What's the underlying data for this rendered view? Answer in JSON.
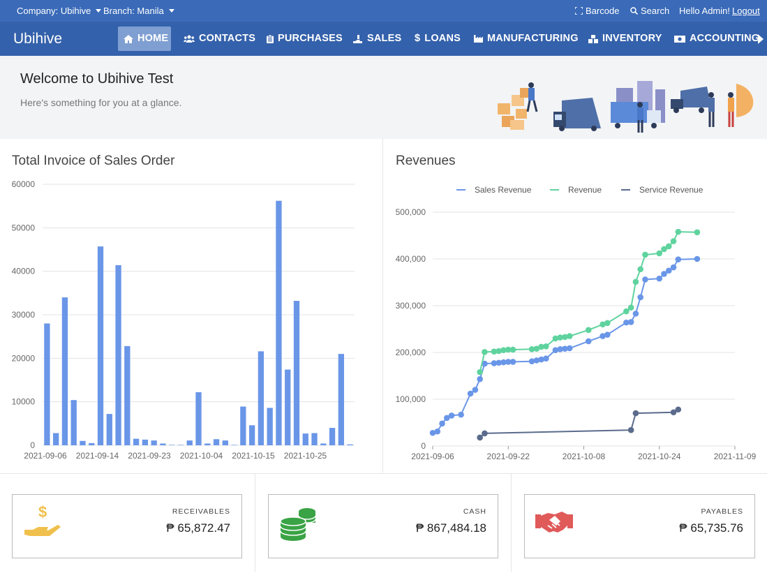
{
  "topbar": {
    "company": "Company: Ubihive",
    "branch": "Branch: Manila",
    "barcode": "Barcode",
    "search": "Search",
    "greeting": "Hello Admin!",
    "logout": "Logout"
  },
  "nav": {
    "brand": "Ubihive",
    "items": [
      {
        "label": "HOME",
        "icon": "home-icon"
      },
      {
        "label": "CONTACTS",
        "icon": "users-icon"
      },
      {
        "label": "PURCHASES",
        "icon": "clipboard-icon"
      },
      {
        "label": "SALES",
        "icon": "hand-coins-icon"
      },
      {
        "label": "LOANS",
        "icon": "dollar-icon"
      },
      {
        "label": "MANUFACTURING",
        "icon": "factory-icon"
      },
      {
        "label": "INVENTORY",
        "icon": "boxes-icon"
      },
      {
        "label": "ACCOUNTING",
        "icon": "money-bill-icon"
      }
    ]
  },
  "welcome": {
    "title": "Welcome to Ubihive Test",
    "subtitle": "Here's something for you at a glance."
  },
  "colors": {
    "topbar": "#3a6ab8",
    "navbar": "#3461ab",
    "bar": "#6a96e8",
    "sales_revenue": "#6a96e8",
    "revenue": "#5fd39e",
    "service_revenue": "#5a6b8c",
    "receivables_icon": "#f0c04c",
    "cash_icon": "#3aa345",
    "payables_icon": "#e05a5a"
  },
  "chart_data": [
    {
      "type": "bar",
      "title": "Total Invoice of Sales Order",
      "ylim": [
        0,
        60000
      ],
      "yticks": [
        0,
        10000,
        20000,
        30000,
        40000,
        50000,
        60000
      ],
      "xtick_labels": [
        "2021-09-06",
        "2021-09-14",
        "2021-09-23",
        "2021-10-04",
        "2021-10-15",
        "2021-10-25"
      ],
      "values": [
        28000,
        2800,
        34000,
        10400,
        1000,
        500,
        45700,
        7200,
        41400,
        22800,
        1500,
        1300,
        1100,
        400,
        100,
        100,
        1100,
        12200,
        400,
        1400,
        1100,
        100,
        8900,
        4600,
        21600,
        8600,
        56200,
        17400,
        33200,
        2700,
        2800,
        400,
        4000,
        21000,
        200
      ],
      "grid": true,
      "legend": "none"
    },
    {
      "type": "line",
      "title": "Revenues",
      "ylim": [
        0,
        500000
      ],
      "yticks": [
        "0",
        "100,000",
        "200,000",
        "300,000",
        "400,000",
        "500,000"
      ],
      "xtick_labels": [
        "2021-09-06",
        "2021-09-22",
        "2021-10-08",
        "2021-10-24",
        "2021-11-09"
      ],
      "xrange": [
        "2021-09-06",
        "2021-11-09"
      ],
      "legend_position": "top",
      "series": [
        {
          "name": "Sales Revenue",
          "points": [
            [
              "2021-09-06",
              28000
            ],
            [
              "2021-09-07",
              31000
            ],
            [
              "2021-09-08",
              48000
            ],
            [
              "2021-09-09",
              60000
            ],
            [
              "2021-09-10",
              65000
            ],
            [
              "2021-09-12",
              67000
            ],
            [
              "2021-09-14",
              112000
            ],
            [
              "2021-09-15",
              120000
            ],
            [
              "2021-09-16",
              143000
            ],
            [
              "2021-09-17",
              176000
            ],
            [
              "2021-09-19",
              177000
            ],
            [
              "2021-09-20",
              178000
            ],
            [
              "2021-09-21",
              179000
            ],
            [
              "2021-09-22",
              180000
            ],
            [
              "2021-09-23",
              180000
            ],
            [
              "2021-09-27",
              181000
            ],
            [
              "2021-09-28",
              183000
            ],
            [
              "2021-09-29",
              185000
            ],
            [
              "2021-09-30",
              187000
            ],
            [
              "2021-10-02",
              205000
            ],
            [
              "2021-10-03",
              207000
            ],
            [
              "2021-10-04",
              208000
            ],
            [
              "2021-10-05",
              209000
            ],
            [
              "2021-10-09",
              224000
            ],
            [
              "2021-10-12",
              235000
            ],
            [
              "2021-10-13",
              238000
            ],
            [
              "2021-10-17",
              264000
            ],
            [
              "2021-10-18",
              265000
            ],
            [
              "2021-10-19",
              283000
            ],
            [
              "2021-10-20",
              318000
            ],
            [
              "2021-10-21",
              356000
            ],
            [
              "2021-10-24",
              358000
            ],
            [
              "2021-10-25",
              368000
            ],
            [
              "2021-10-26",
              375000
            ],
            [
              "2021-10-27",
              382000
            ],
            [
              "2021-10-28",
              399000
            ],
            [
              "2021-11-01",
              400000
            ]
          ]
        },
        {
          "name": "Revenue",
          "points": [
            [
              "2021-09-16",
              158000
            ],
            [
              "2021-09-17",
              201000
            ],
            [
              "2021-09-19",
              202000
            ],
            [
              "2021-09-20",
              203000
            ],
            [
              "2021-09-21",
              205000
            ],
            [
              "2021-09-22",
              206000
            ],
            [
              "2021-09-23",
              206000
            ],
            [
              "2021-09-27",
              207000
            ],
            [
              "2021-09-28",
              208000
            ],
            [
              "2021-09-29",
              212000
            ],
            [
              "2021-09-30",
              213000
            ],
            [
              "2021-10-02",
              230000
            ],
            [
              "2021-10-03",
              232000
            ],
            [
              "2021-10-04",
              233000
            ],
            [
              "2021-10-05",
              235000
            ],
            [
              "2021-10-09",
              248000
            ],
            [
              "2021-10-12",
              260000
            ],
            [
              "2021-10-13",
              263000
            ],
            [
              "2021-10-17",
              288000
            ],
            [
              "2021-10-18",
              296000
            ],
            [
              "2021-10-19",
              351000
            ],
            [
              "2021-10-20",
              378000
            ],
            [
              "2021-10-21",
              409000
            ],
            [
              "2021-10-24",
              412000
            ],
            [
              "2021-10-25",
              421000
            ],
            [
              "2021-10-26",
              427000
            ],
            [
              "2021-10-27",
              438000
            ],
            [
              "2021-10-28",
              458000
            ],
            [
              "2021-11-01",
              457000
            ]
          ]
        },
        {
          "name": "Service Revenue",
          "points": [
            [
              "2021-09-16",
              18000
            ],
            [
              "2021-09-17",
              27000
            ],
            [
              "2021-10-18",
              34000
            ],
            [
              "2021-10-19",
              70000
            ],
            [
              "2021-10-27",
              72000
            ],
            [
              "2021-10-28",
              78000
            ]
          ]
        }
      ]
    }
  ],
  "cards": [
    {
      "label": "RECEIVABLES",
      "value": "₱ 65,872.47",
      "icon": "hand-dollar-icon"
    },
    {
      "label": "CASH",
      "value": "₱ 867,484.18",
      "icon": "coins-stack-icon"
    },
    {
      "label": "PAYABLES",
      "value": "₱ 65,735.76",
      "icon": "handshake-icon"
    }
  ]
}
